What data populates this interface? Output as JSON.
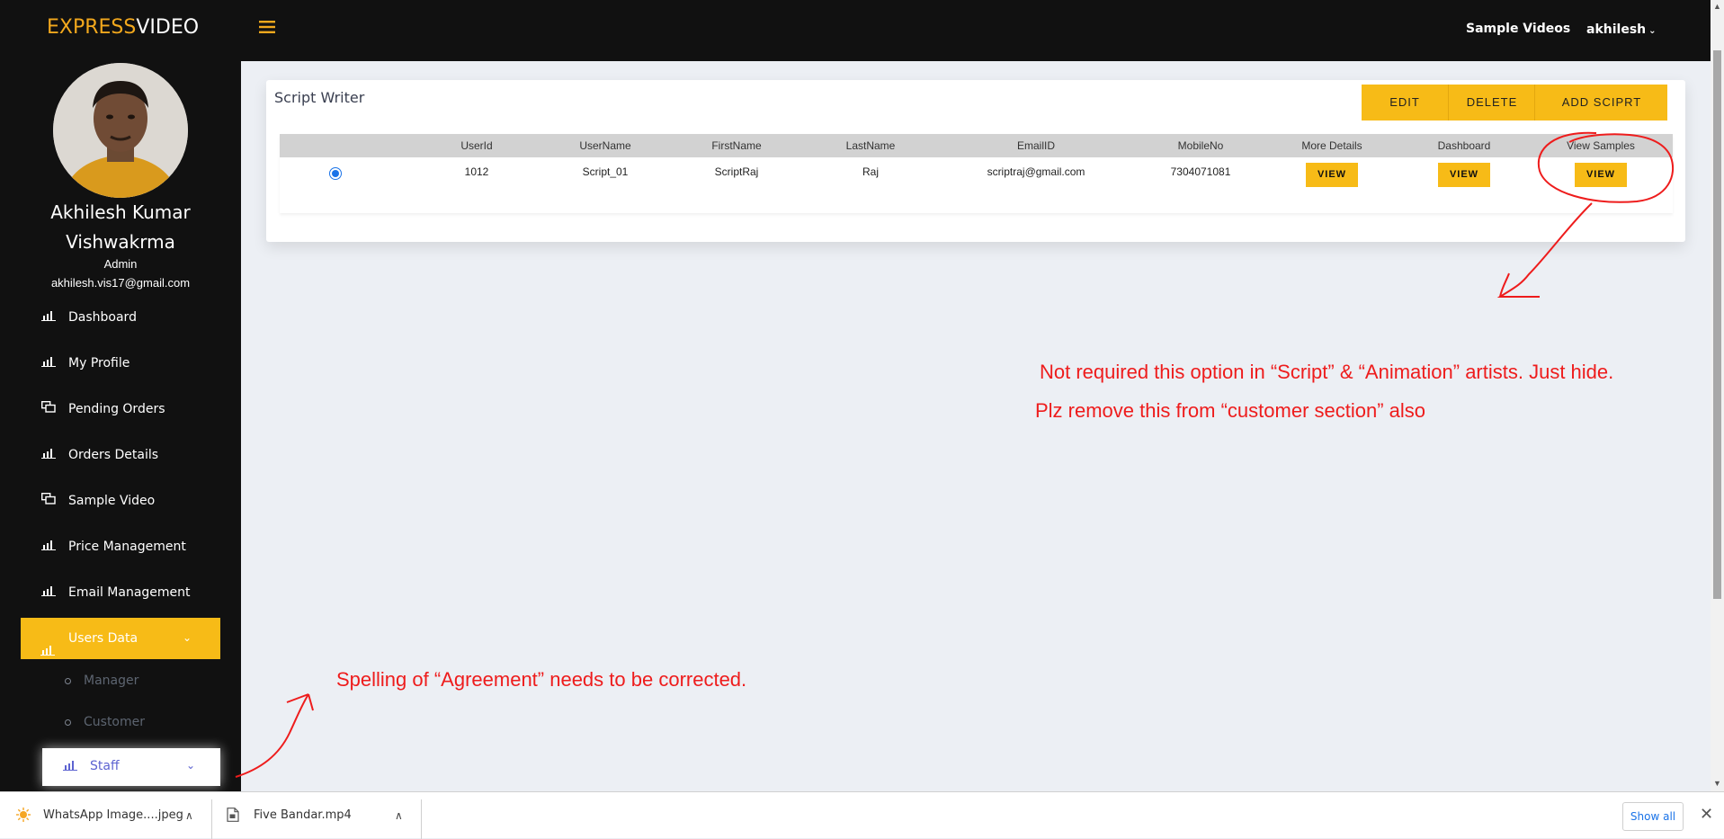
{
  "header": {
    "logo_part1": "EXPRESS",
    "logo_part2": "VIDEO",
    "menu_icon": "hamburger-icon",
    "sample_videos_link": "Sample Videos",
    "user_name": "akhilesh",
    "user_chevron": "⌄"
  },
  "profile": {
    "name_line1": "Akhilesh Kumar",
    "name_line2": "Vishwakrma",
    "role": "Admin",
    "email": "akhilesh.vis17@gmail.com"
  },
  "sidebar": {
    "items": [
      {
        "label": "Dashboard",
        "icon": "bar-chart-icon"
      },
      {
        "label": "My Profile",
        "icon": "bar-chart-icon"
      },
      {
        "label": "Pending Orders",
        "icon": "stack-icon"
      },
      {
        "label": "Orders Details",
        "icon": "bar-chart-icon"
      },
      {
        "label": "Sample Video",
        "icon": "stack-icon"
      },
      {
        "label": "Price Management",
        "icon": "bar-chart-icon"
      },
      {
        "label": "Email Management",
        "icon": "bar-chart-icon"
      }
    ],
    "active": {
      "label": "Users Data",
      "icon": "bar-chart-icon",
      "chevron": "⌄"
    },
    "sub_items": [
      "Manager",
      "Customer"
    ],
    "staff": {
      "label": "Staff",
      "icon": "bar-chart-icon",
      "chevron": "⌄"
    }
  },
  "main": {
    "card_title": "Script Writer",
    "buttons": {
      "edit": "EDIT",
      "delete": "DELETE",
      "add": "ADD SCIPRT"
    },
    "table": {
      "headers": [
        "UserId",
        "UserName",
        "FirstName",
        "LastName",
        "EmailID",
        "MobileNo",
        "More Details",
        "Dashboard",
        "View Samples"
      ],
      "rows": [
        {
          "selected": true,
          "user_id": "1012",
          "user_name": "Script_01",
          "first_name": "ScriptRaj",
          "last_name": "Raj",
          "email": "scriptraj@gmail.com",
          "mobile": "7304071081",
          "more_details": "VIEW",
          "dashboard": "VIEW",
          "view_samples": "VIEW"
        }
      ]
    }
  },
  "annotations": {
    "note1": "Not required this option in “Script” & “Animation” artists. Just hide.",
    "note2": "Plz remove this from “customer section” also",
    "note3": "Spelling of “Agreement” needs to be corrected.",
    "color": "#ee1c1c"
  },
  "downloads": {
    "items": [
      {
        "name": "WhatsApp Image....jpeg",
        "icon": "image-file-icon"
      },
      {
        "name": "Five Bandar.mp4",
        "icon": "video-file-icon"
      }
    ],
    "show_all": "Show all",
    "close": "✕"
  },
  "colors": {
    "accent": "#f7bb17",
    "sidebar_bg": "#111111",
    "content_bg": "#eceff4"
  }
}
